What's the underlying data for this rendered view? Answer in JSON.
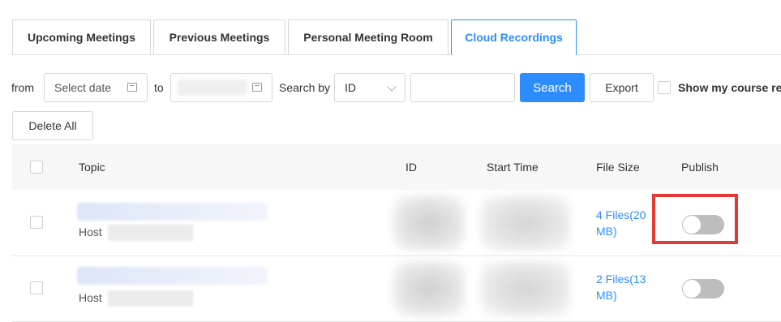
{
  "tabs": [
    {
      "label": "Upcoming Meetings"
    },
    {
      "label": "Previous Meetings"
    },
    {
      "label": "Personal Meeting Room"
    },
    {
      "label": "Cloud Recordings",
      "active": true
    }
  ],
  "filters": {
    "from_label": "from",
    "from_placeholder": "Select date",
    "to_label": "to",
    "search_by_label": "Search by",
    "search_by_value": "ID",
    "search_button": "Search",
    "export_button": "Export",
    "show_course_label": "Show my course rec"
  },
  "actions": {
    "delete_all": "Delete All"
  },
  "table": {
    "columns": [
      "Topic",
      "ID",
      "Start Time",
      "File Size",
      "Publish"
    ],
    "rows": [
      {
        "host_label": "Host",
        "file_size": "4 Files(20 MB)",
        "publish": false
      },
      {
        "host_label": "Host",
        "file_size": "2 Files(13 MB)",
        "publish": false
      }
    ]
  },
  "colors": {
    "accent": "#2d8cff",
    "highlight": "#e53935",
    "toggle_off": "#bdbdbd"
  },
  "icons": [
    "calendar-icon",
    "chevron-down-icon"
  ]
}
